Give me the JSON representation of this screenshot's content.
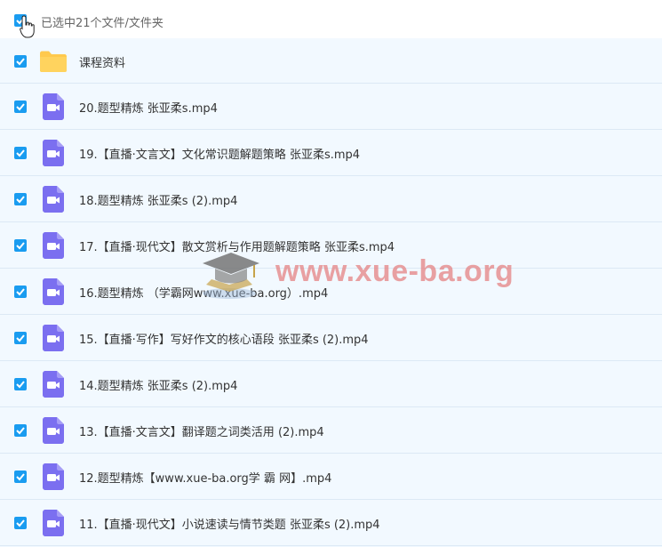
{
  "header": {
    "selection_text": "已选中21个文件/文件夹"
  },
  "files": [
    {
      "name": "课程资料",
      "type": "folder"
    },
    {
      "name": "20.题型精炼 张亚柔s.mp4",
      "type": "video"
    },
    {
      "name": "19.【直播·文言文】文化常识题解题策略 张亚柔s.mp4",
      "type": "video"
    },
    {
      "name": "18.题型精炼 张亚柔s (2).mp4",
      "type": "video"
    },
    {
      "name": "17.【直播·现代文】散文赏析与作用题解题策略 张亚柔s.mp4",
      "type": "video"
    },
    {
      "name": "16.题型精炼 （学霸网www.xue-ba.org）.mp4",
      "type": "video"
    },
    {
      "name": "15.【直播·写作】写好作文的核心语段 张亚柔s (2).mp4",
      "type": "video"
    },
    {
      "name": "14.题型精炼 张亚柔s (2).mp4",
      "type": "video"
    },
    {
      "name": "13.【直播·文言文】翻译题之词类活用 (2).mp4",
      "type": "video"
    },
    {
      "name": "12.题型精炼【www.xue-ba.org学 霸 网】.mp4",
      "type": "video"
    },
    {
      "name": "11.【直播·现代文】小说速读与情节类题 张亚柔s (2).mp4",
      "type": "video"
    }
  ],
  "watermark": {
    "text": "www.xue-ba.org"
  },
  "colors": {
    "checkbox": "#1a9cf0",
    "folder": "#ffc94d",
    "video": "#7b6ff0"
  }
}
